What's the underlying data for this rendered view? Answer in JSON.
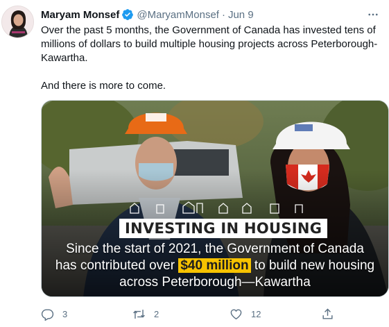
{
  "author": {
    "display_name": "Maryam Monsef",
    "handle": "@MaryamMonsef",
    "separator": "·",
    "date": "Jun 9",
    "verified": true
  },
  "tweet": {
    "paragraph1": "Over the past 5 months, the Government of Canada has invested tens of millions of dollars to build multiple housing projects across Peterborough-Kawartha.",
    "paragraph2": "And there is more to come."
  },
  "media": {
    "title": "INVESTING IN HOUSING",
    "caption_line1": "Since the start of 2021, the Government of Canada",
    "caption_line2_before": "has contributed over ",
    "caption_highlight": "$40 million",
    "caption_line2_after": " to build new housing",
    "caption_line3": "across Peterborough—Kawartha"
  },
  "actions": {
    "replies": "3",
    "retweets": "2",
    "likes": "12"
  },
  "colors": {
    "text": "#0f1419",
    "secondary": "#5b7083",
    "verified": "#1d9bf0",
    "highlight": "#f6c200"
  },
  "icons": [
    "verified-badge-icon",
    "more-options-icon",
    "reply-icon",
    "retweet-icon",
    "like-icon",
    "share-icon"
  ]
}
